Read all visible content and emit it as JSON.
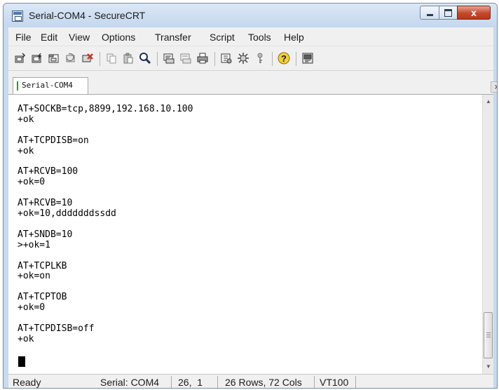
{
  "window": {
    "title": "Serial-COM4 - SecureCRT",
    "controls": {
      "minimize": "minimize-icon",
      "maximize": "maximize-icon",
      "close": "x"
    }
  },
  "menu": [
    "File",
    "Edit",
    "View",
    "Options",
    "Transfer",
    "Script",
    "Tools",
    "Help"
  ],
  "toolbar": {
    "icons": [
      "connect-icon",
      "quick-connect-icon",
      "connect-in-tab-icon",
      "reconnect-icon",
      "disconnect-icon",
      "copy-icon",
      "paste-icon",
      "find-icon",
      "print-screen-icon",
      "print-selection-icon",
      "print-icon",
      "session-options-icon",
      "global-options-icon",
      "keymap-icon",
      "help-icon",
      "sftp-icon"
    ]
  },
  "tab": {
    "label": "Serial-COM4",
    "status_color": "#1aa11a"
  },
  "terminal": {
    "lines": [
      "AT+SOCKB=tcp,8899,192.168.10.100",
      "+ok",
      "",
      "AT+TCPDISB=on",
      "+ok",
      "",
      "AT+RCVB=100",
      "+ok=0",
      "",
      "AT+RCVB=10",
      "+ok=10,dddddddssdd",
      "",
      "AT+SNDB=10",
      ">+ok=1",
      "",
      "AT+TCPLKB",
      "+ok=on",
      "",
      "AT+TCPTOB",
      "+ok=0",
      "",
      "AT+TCPDISB=off",
      "+ok"
    ]
  },
  "status": {
    "state": "Ready",
    "connection": "Serial: COM4",
    "cursor_pos": "26,  1",
    "size": "26 Rows, 72 Cols",
    "emulation": "VT100"
  }
}
